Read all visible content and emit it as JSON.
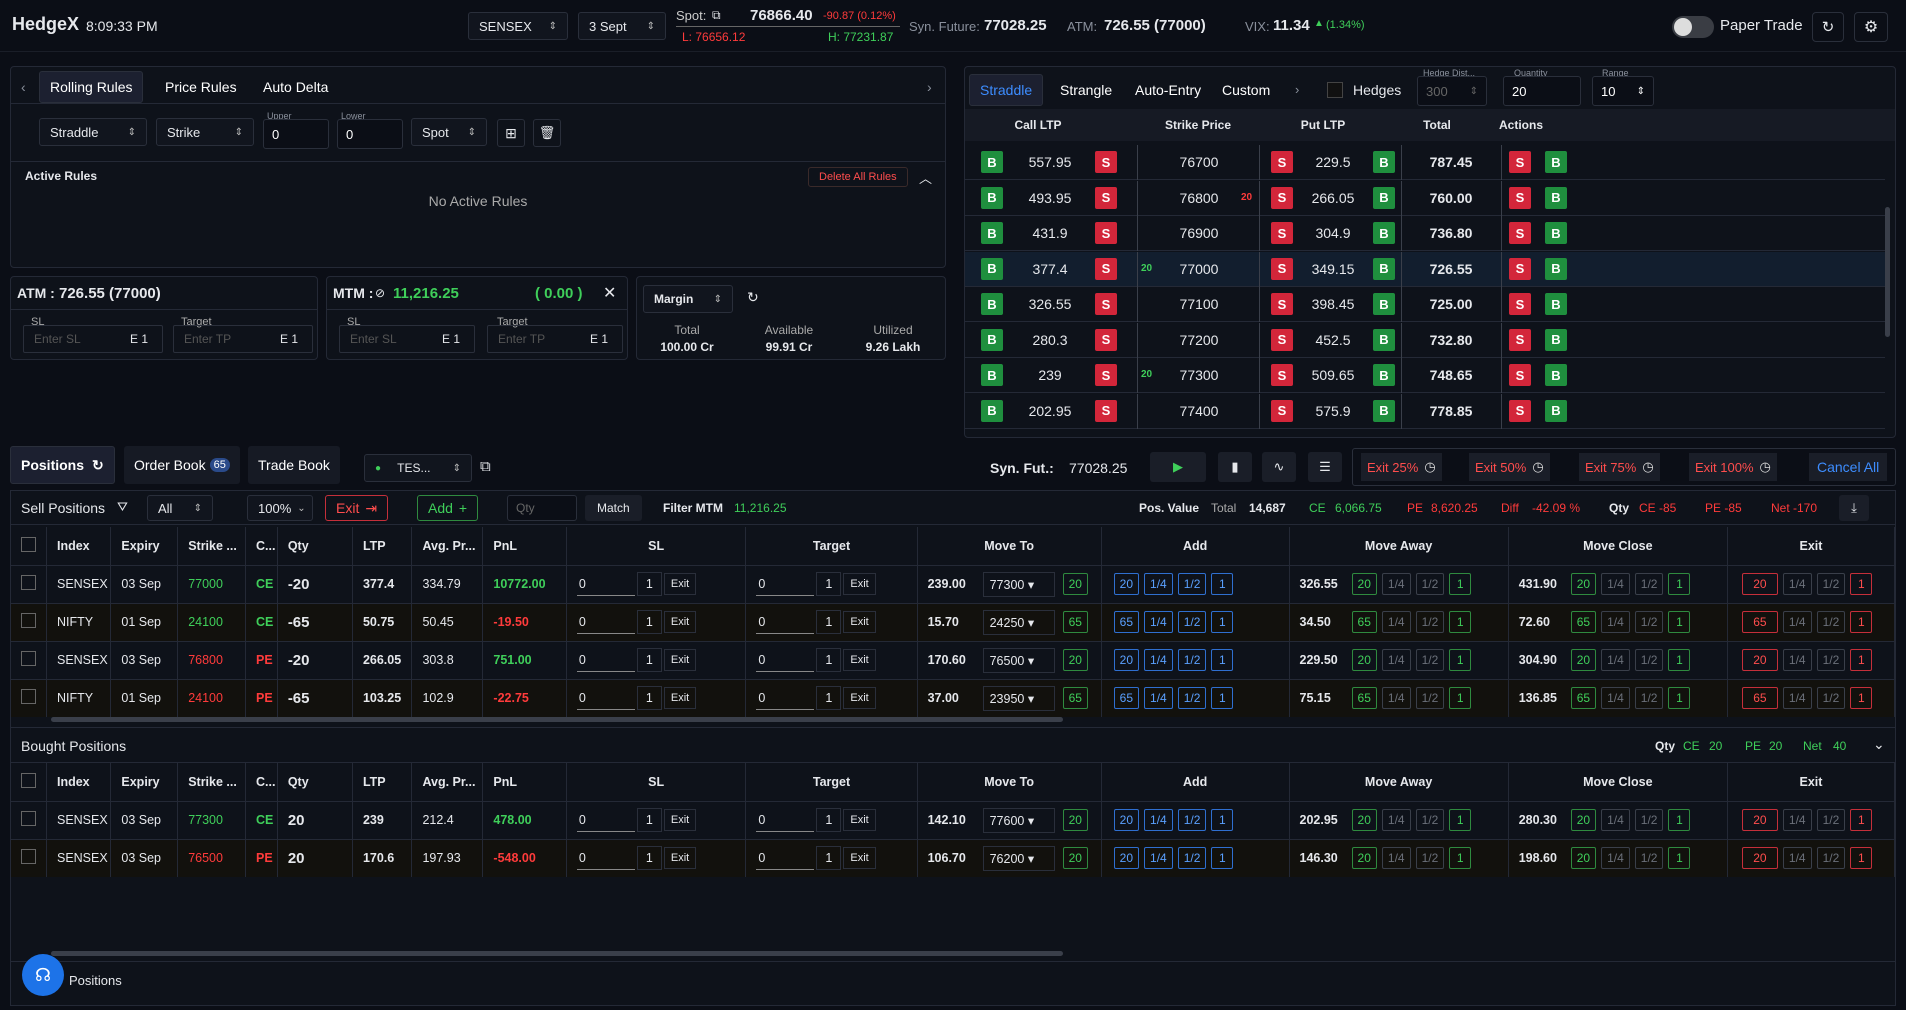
{
  "header": {
    "brand": "HedgeX",
    "time": "8:09:33 PM",
    "index": "SENSEX",
    "expiry": "3 Sept",
    "spot_label": "Spot:",
    "spot_value": "76866.40",
    "spot_change": "-90.87 (0.12%)",
    "low": "L: 76656.12",
    "high": "H: 77231.87",
    "synf_label": "Syn. Future:",
    "synf_value": "77028.25",
    "atm_label": "ATM:",
    "atm_value": "726.55 (77000)",
    "vix_label": "VIX:",
    "vix_value": "11.34",
    "vix_change": "(1.34%)",
    "paper_trade": "Paper Trade"
  },
  "rules": {
    "tabs": [
      "Rolling Rules",
      "Price Rules",
      "Auto Delta"
    ],
    "type": "Straddle",
    "strike": "Strike",
    "upper_label": "Upper",
    "upper": "0",
    "lower_label": "Lower",
    "lower": "0",
    "ref": "Spot",
    "active_title": "Active Rules",
    "delete_all": "Delete All Rules",
    "empty": "No Active Rules"
  },
  "atm_box": {
    "title": "ATM :",
    "value": "726.55 (77000)",
    "sl": "SL",
    "sl_ph": "Enter SL",
    "target": "Target",
    "tp_ph": "Enter TP",
    "e1": "E 1"
  },
  "mtm_box": {
    "title": "MTM :",
    "value": "11,216.25",
    "change": "( 0.00 )",
    "sl": "SL",
    "sl_ph": "Enter SL",
    "target": "Target",
    "tp_ph": "Enter TP",
    "e1": "E 1"
  },
  "margin": {
    "select": "Margin",
    "total_label": "Total",
    "total": "100.00 Cr",
    "avail_label": "Available",
    "avail": "99.91 Cr",
    "util_label": "Utilized",
    "util": "9.26 Lakh"
  },
  "chain": {
    "tabs": [
      "Straddle",
      "Strangle",
      "Auto-Entry",
      "Custom"
    ],
    "hedges": "Hedges",
    "hedge_dist_label": "Hedge Dist...",
    "hedge_dist": "300",
    "qty_label": "Quantity",
    "qty": "20",
    "range_label": "Range",
    "range": "10",
    "headers": [
      "Call LTP",
      "Strike Price",
      "Put LTP",
      "Total",
      "Actions"
    ],
    "b": "B",
    "s": "S",
    "rows": [
      {
        "call": "557.95",
        "strike": "76700",
        "put": "229.5",
        "total": "787.45",
        "lq": "",
        "rq": ""
      },
      {
        "call": "493.95",
        "strike": "76800",
        "put": "266.05",
        "total": "760.00",
        "lq": "",
        "rq": "20"
      },
      {
        "call": "431.9",
        "strike": "76900",
        "put": "304.9",
        "total": "736.80",
        "lq": "",
        "rq": ""
      },
      {
        "call": "377.4",
        "strike": "77000",
        "put": "349.15",
        "total": "726.55",
        "lq": "20",
        "rq": ""
      },
      {
        "call": "326.55",
        "strike": "77100",
        "put": "398.45",
        "total": "725.00",
        "lq": "",
        "rq": ""
      },
      {
        "call": "280.3",
        "strike": "77200",
        "put": "452.5",
        "total": "732.80",
        "lq": "",
        "rq": ""
      },
      {
        "call": "239",
        "strike": "77300",
        "put": "509.65",
        "total": "748.65",
        "lq": "20",
        "rq": ""
      },
      {
        "call": "202.95",
        "strike": "77400",
        "put": "575.9",
        "total": "778.85",
        "lq": "",
        "rq": ""
      }
    ]
  },
  "book": {
    "tabs": [
      "Positions",
      "Order Book",
      "Trade Book"
    ],
    "order_count": "65",
    "strategy": "TES...",
    "synfut_label": "Syn. Fut.:",
    "synfut": "77028.25",
    "exits": [
      "Exit 25%",
      "Exit 50%",
      "Exit 75%",
      "Exit 100%"
    ],
    "cancel_all": "Cancel All"
  },
  "sell": {
    "title": "Sell Positions",
    "filter": "All",
    "pct": "100%",
    "exit": "Exit",
    "add": "Add",
    "qty_ph": "Qty",
    "match": "Match",
    "filter_mtm_label": "Filter MTM",
    "filter_mtm": "11,216.25",
    "pos_value": "Pos. Value",
    "total_label": "Total",
    "total": "14,687",
    "ce_label": "CE",
    "ce": "6,066.75",
    "pe_label": "PE",
    "pe": "8,620.25",
    "diff_label": "Diff",
    "diff": "-42.09 %",
    "qty_label": "Qty",
    "qce": "CE -85",
    "qpe": "PE -85",
    "qnet": "Net -170",
    "rows": [
      {
        "index": "SENSEX",
        "expiry": "03 Sep",
        "strike": "77000",
        "type": "CE",
        "qty": "-20",
        "ltp": "377.4",
        "avg": "334.79",
        "pnl": "10772.00",
        "move": "239.00",
        "mstrike": "77300",
        "mq": "20",
        "away": "326.55",
        "close": "431.90"
      },
      {
        "index": "NIFTY",
        "expiry": "01 Sep",
        "strike": "24100",
        "type": "CE",
        "qty": "-65",
        "ltp": "50.75",
        "avg": "50.45",
        "pnl": "-19.50",
        "move": "15.70",
        "mstrike": "24250",
        "mq": "65",
        "away": "34.50",
        "close": "72.60"
      },
      {
        "index": "SENSEX",
        "expiry": "03 Sep",
        "strike": "76800",
        "type": "PE",
        "qty": "-20",
        "ltp": "266.05",
        "avg": "303.8",
        "pnl": "751.00",
        "move": "170.60",
        "mstrike": "76500",
        "mq": "20",
        "away": "229.50",
        "close": "304.90"
      },
      {
        "index": "NIFTY",
        "expiry": "01 Sep",
        "strike": "24100",
        "type": "PE",
        "qty": "-65",
        "ltp": "103.25",
        "avg": "102.9",
        "pnl": "-22.75",
        "move": "37.00",
        "mstrike": "23950",
        "mq": "65",
        "away": "75.15",
        "close": "136.85"
      }
    ]
  },
  "bought": {
    "title": "Bought Positions",
    "qty_label": "Qty",
    "ce_label": "CE",
    "ce": "20",
    "pe_label": "PE",
    "pe": "20",
    "net_label": "Net",
    "net": "40",
    "rows": [
      {
        "index": "SENSEX",
        "expiry": "03 Sep",
        "strike": "77300",
        "type": "CE",
        "qty": "20",
        "ltp": "239",
        "avg": "212.4",
        "pnl": "478.00",
        "move": "142.10",
        "mstrike": "77600",
        "mq": "20",
        "away": "202.95",
        "close": "280.30"
      },
      {
        "index": "SENSEX",
        "expiry": "03 Sep",
        "strike": "76500",
        "type": "PE",
        "qty": "20",
        "ltp": "170.6",
        "avg": "197.93",
        "pnl": "-548.00",
        "move": "106.70",
        "mstrike": "76200",
        "mq": "20",
        "away": "146.30",
        "close": "198.60"
      }
    ]
  },
  "cols": [
    "Index",
    "Expiry",
    "Strike ...",
    "C...",
    "Qty",
    "LTP",
    "Avg. Pr...",
    "PnL",
    "SL",
    "Target",
    "Move To",
    "Add",
    "Move Away",
    "Move Close",
    "Exit"
  ],
  "cells": {
    "zero": "0",
    "one": "1",
    "exit": "Exit",
    "q14": "1/4",
    "q12": "1/2",
    "q1": "1"
  },
  "footer": {
    "positions": "Positions"
  }
}
